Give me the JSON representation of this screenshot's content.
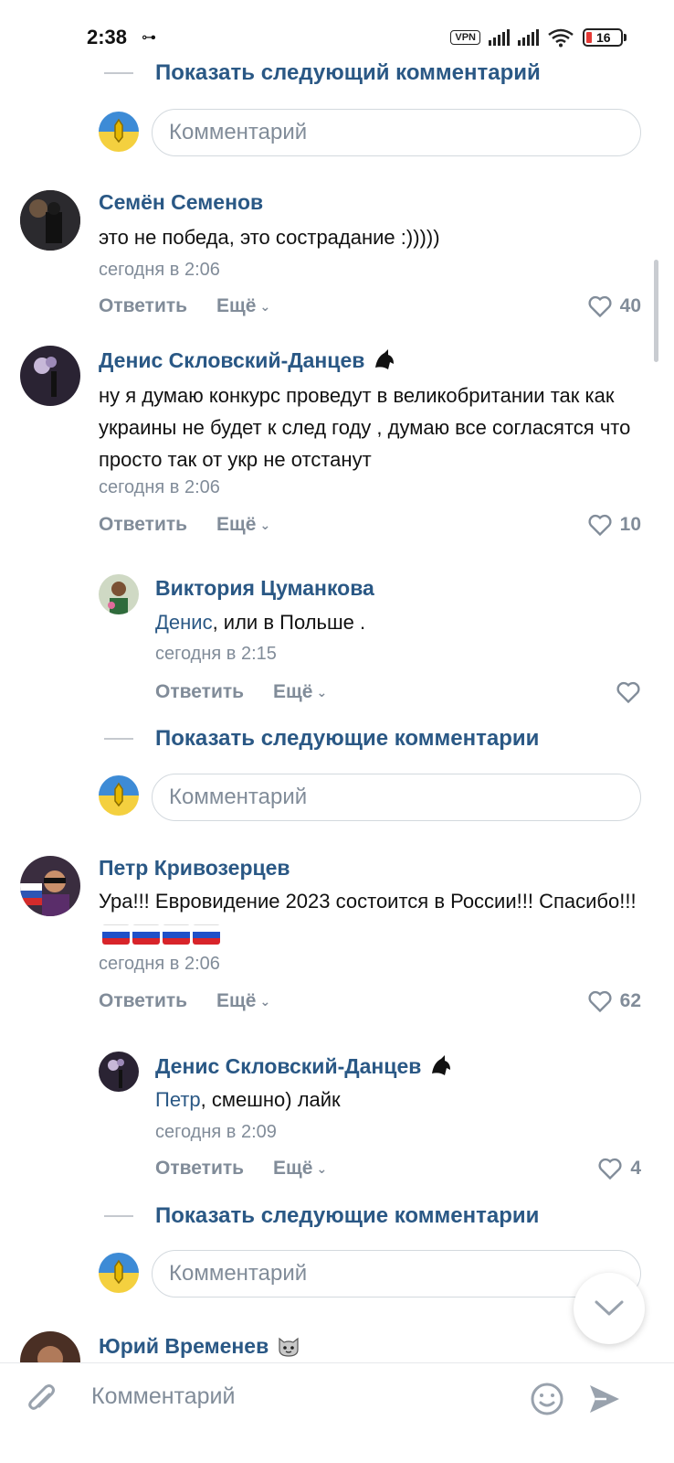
{
  "status": {
    "time": "2:38",
    "vpn": "VPN",
    "battery": "16"
  },
  "show_next_single": "Показать следующий комментарий",
  "show_next_multi": "Показать следующие комментарии",
  "comment_placeholder": "Комментарий",
  "comments": [
    {
      "author": "Семён Семенов",
      "text": "это не победа, это сострадание :)))))",
      "time": "сегодня в 2:06",
      "reply": "Ответить",
      "more": "Ещё",
      "likes": "40"
    },
    {
      "author": "Денис Скловский-Данцев",
      "text": "ну я думаю конкурс проведут в великобритании так как украины не будет к след году , думаю все согласятся что просто так от укр не отстанут",
      "time": "сегодня в 2:06",
      "reply": "Ответить",
      "more": "Ещё",
      "likes": "10"
    },
    {
      "author": "Виктория Цуманкова",
      "mention": "Денис",
      "text": ", или в Польше .",
      "time": "сегодня в 2:15",
      "reply": "Ответить",
      "more": "Ещё",
      "likes": ""
    },
    {
      "author": "Петр Кривозерцев",
      "text": "Ура!!! Евровидение 2023 состоится в России!!! Спасибо!!!",
      "time": "сегодня в 2:06",
      "reply": "Ответить",
      "more": "Ещё",
      "likes": "62"
    },
    {
      "author": "Денис Скловский-Данцев",
      "mention": "Петр",
      "text": ", смешно) лайк",
      "time": "сегодня в 2:09",
      "reply": "Ответить",
      "more": "Ещё",
      "likes": "4"
    },
    {
      "author": "Юрий Временев"
    }
  ],
  "bottom": {
    "placeholder": "Комментарий"
  },
  "colors": {
    "link": "#2a5885",
    "meta": "#818c99",
    "divider": "#d3d9de"
  }
}
